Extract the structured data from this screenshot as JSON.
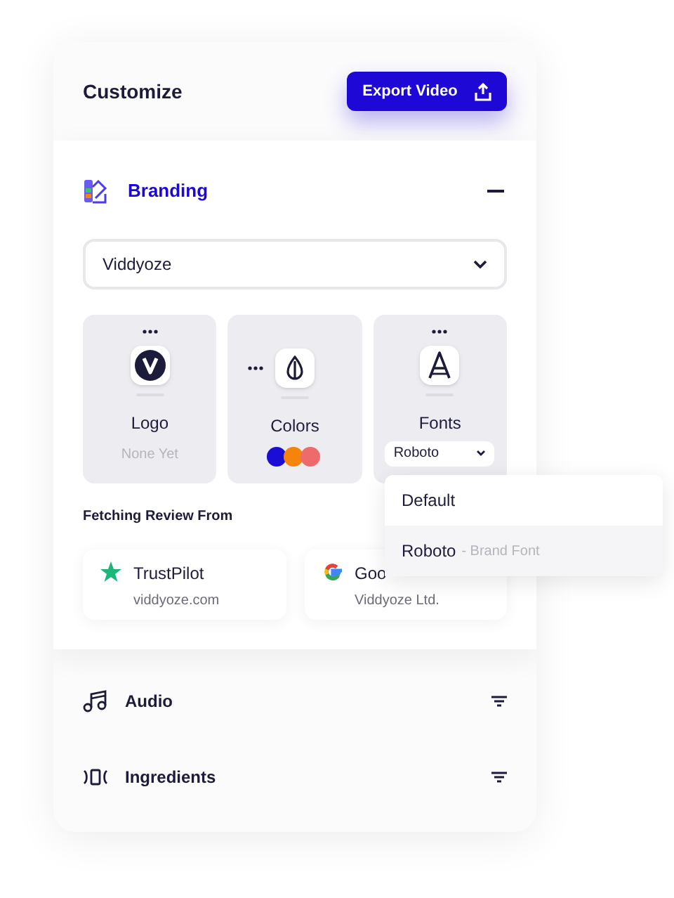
{
  "header": {
    "title": "Customize",
    "export_button": "Export Video"
  },
  "branding": {
    "title": "Branding",
    "expanded": true,
    "brand_select": "Viddyoze",
    "tiles": [
      {
        "kind": "logo",
        "label": "Logo",
        "value": "None Yet"
      },
      {
        "kind": "colors",
        "label": "Colors",
        "swatches": [
          {
            "color": "#1a0dd6"
          },
          {
            "color": "#f5840c"
          },
          {
            "color": "#ee6b6b"
          }
        ]
      },
      {
        "kind": "fonts",
        "label": "Fonts",
        "value": "Roboto"
      }
    ],
    "reviews_label": "Fetching Review From",
    "reviews": [
      {
        "kind": "star",
        "name": "TrustPilot",
        "source": "viddyoze.com"
      },
      {
        "kind": "google",
        "name": "Goo",
        "source": "Viddyoze Ltd."
      }
    ]
  },
  "font_menu": [
    {
      "label": "Default",
      "selected": false
    },
    {
      "label": "Roboto",
      "note": "- Brand Font",
      "selected": true
    }
  ],
  "sections": [
    {
      "kind": "audio",
      "title": "Audio"
    },
    {
      "kind": "ingredients",
      "title": "Ingredients"
    }
  ]
}
